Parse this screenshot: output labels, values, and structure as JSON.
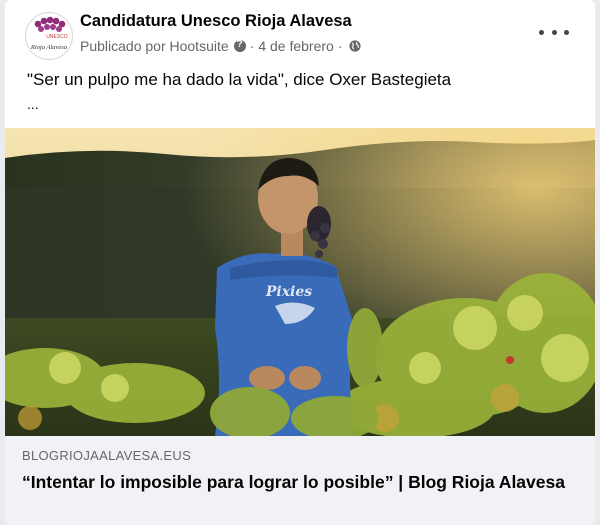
{
  "post": {
    "page_name": "Candidatura Unesco Rioja Alavesa",
    "published_by": "Publicado por Hootsuite",
    "date": "4 de febrero",
    "separator": "·",
    "text": "\"Ser un pulpo me ha dado la vida\", dice Oxer Bastegieta",
    "truncation": "...",
    "avatar_text": "Rioja Alavesa",
    "avatar_small_text": "UNESCO"
  },
  "link_preview": {
    "domain": "BLOGRIOJAALAVESA.EUS",
    "title": "“Intentar lo imposible para lograr lo posible” | Blog Rioja Alavesa"
  },
  "photo": {
    "shirt_text": "Pixies"
  },
  "icons": {
    "help": "question-circle-icon",
    "privacy": "globe-icon",
    "more": "more-horizontal-icon"
  },
  "colors": {
    "page_bg": "#e9ebee",
    "card_bg": "#ffffff",
    "link_box_bg": "#f0f2f5",
    "secondary_text": "#65676b",
    "grape_purple": "#8e2c7a"
  }
}
